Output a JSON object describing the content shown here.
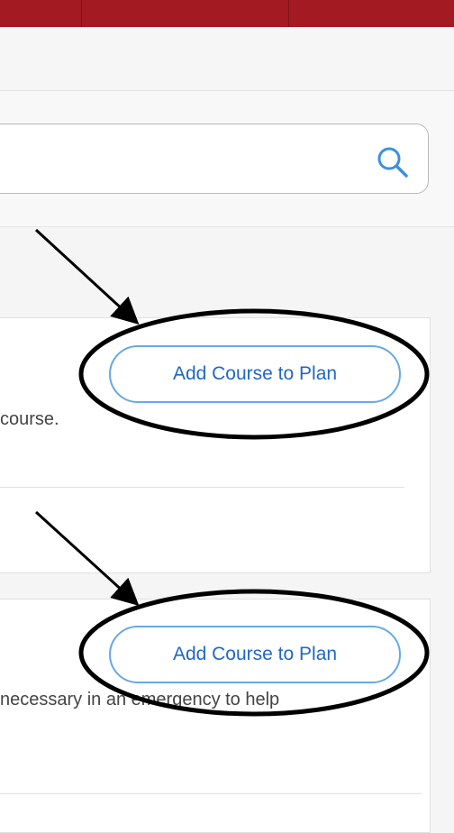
{
  "search": {
    "placeholder": "",
    "value": "",
    "icon": "search-icon"
  },
  "courses": [
    {
      "add_label": "Add Course to Plan",
      "description": "course."
    },
    {
      "add_label": "Add Course to Plan",
      "description": "necessary in an emergency to help"
    }
  ],
  "colors": {
    "brand": "#a31a22",
    "button_text": "#1f67c6",
    "button_border": "#67a9e6",
    "annotation": "#000000"
  }
}
